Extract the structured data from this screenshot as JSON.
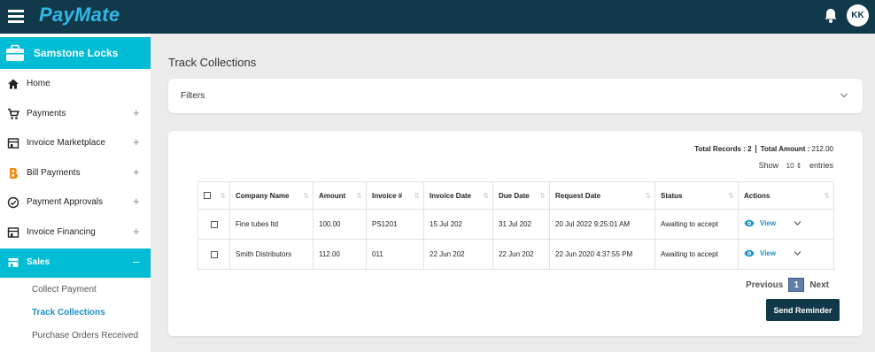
{
  "header": {
    "brand": "PayMate",
    "avatar_initials": "KK"
  },
  "sidebar": {
    "company": "Samstone Locks",
    "items": [
      {
        "label": "Home",
        "expandable": false
      },
      {
        "label": "Payments",
        "expandable": true
      },
      {
        "label": "Invoice Marketplace",
        "expandable": true
      },
      {
        "label": "Bill Payments",
        "expandable": true
      },
      {
        "label": "Payment Approvals",
        "expandable": true
      },
      {
        "label": "Invoice Financing",
        "expandable": true
      },
      {
        "label": "Sales",
        "expandable": true,
        "expanded": true
      }
    ],
    "plus": "+",
    "minus": "–",
    "sub_items": [
      "Collect Payment",
      "Track Collections",
      "Purchase Orders Received"
    ],
    "active_sub_item": "Track Collections"
  },
  "main": {
    "title": "Track Collections",
    "filters_label": "Filters",
    "totals": {
      "records_label": "Total Records :",
      "records_value": "2",
      "amount_label": "Total Amount :",
      "amount_value": "212.00"
    },
    "show_label": "Show",
    "entries_value": "10",
    "entries_label": "entries",
    "table": {
      "headers": [
        "Company Name",
        "Amount",
        "Invoice #",
        "Invoice Date",
        "Due Date",
        "Request Date",
        "Status",
        "Actions"
      ],
      "rows": [
        {
          "company": "Fine tubes ltd",
          "amount": "100.00",
          "invoice": "PS1201",
          "invoice_date": "15 Jul 202",
          "due_date": "31 Jul 202",
          "request_date": "20 Jul 2022 9:25:01 AM",
          "status": "Awaiting to accept",
          "action": "View"
        },
        {
          "company": "Smith Distributors",
          "amount": "112.00",
          "invoice": "011",
          "invoice_date": "22 Jun 202",
          "due_date": "22 Jun 202",
          "request_date": "22 Jun 2020 4:37:55 PM",
          "status": "Awaiting to accept",
          "action": "View"
        }
      ]
    },
    "pagination": {
      "previous": "Previous",
      "current": "1",
      "next": "Next"
    },
    "send_reminder_label": "Send Reminder"
  },
  "colors": {
    "topbar": "#12394a",
    "brand": "#2fb8e6",
    "active": "#00bcd4",
    "link": "#1d8fc9",
    "background": "#ebebeb"
  }
}
